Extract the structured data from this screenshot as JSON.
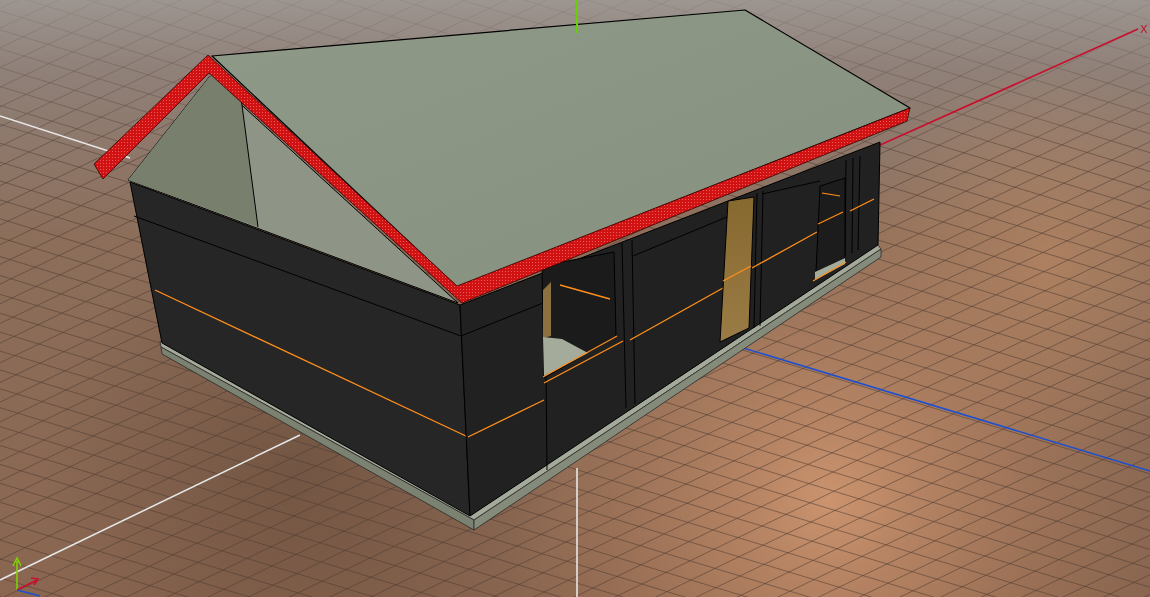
{
  "viewport": {
    "x_axis_label": "X"
  }
}
